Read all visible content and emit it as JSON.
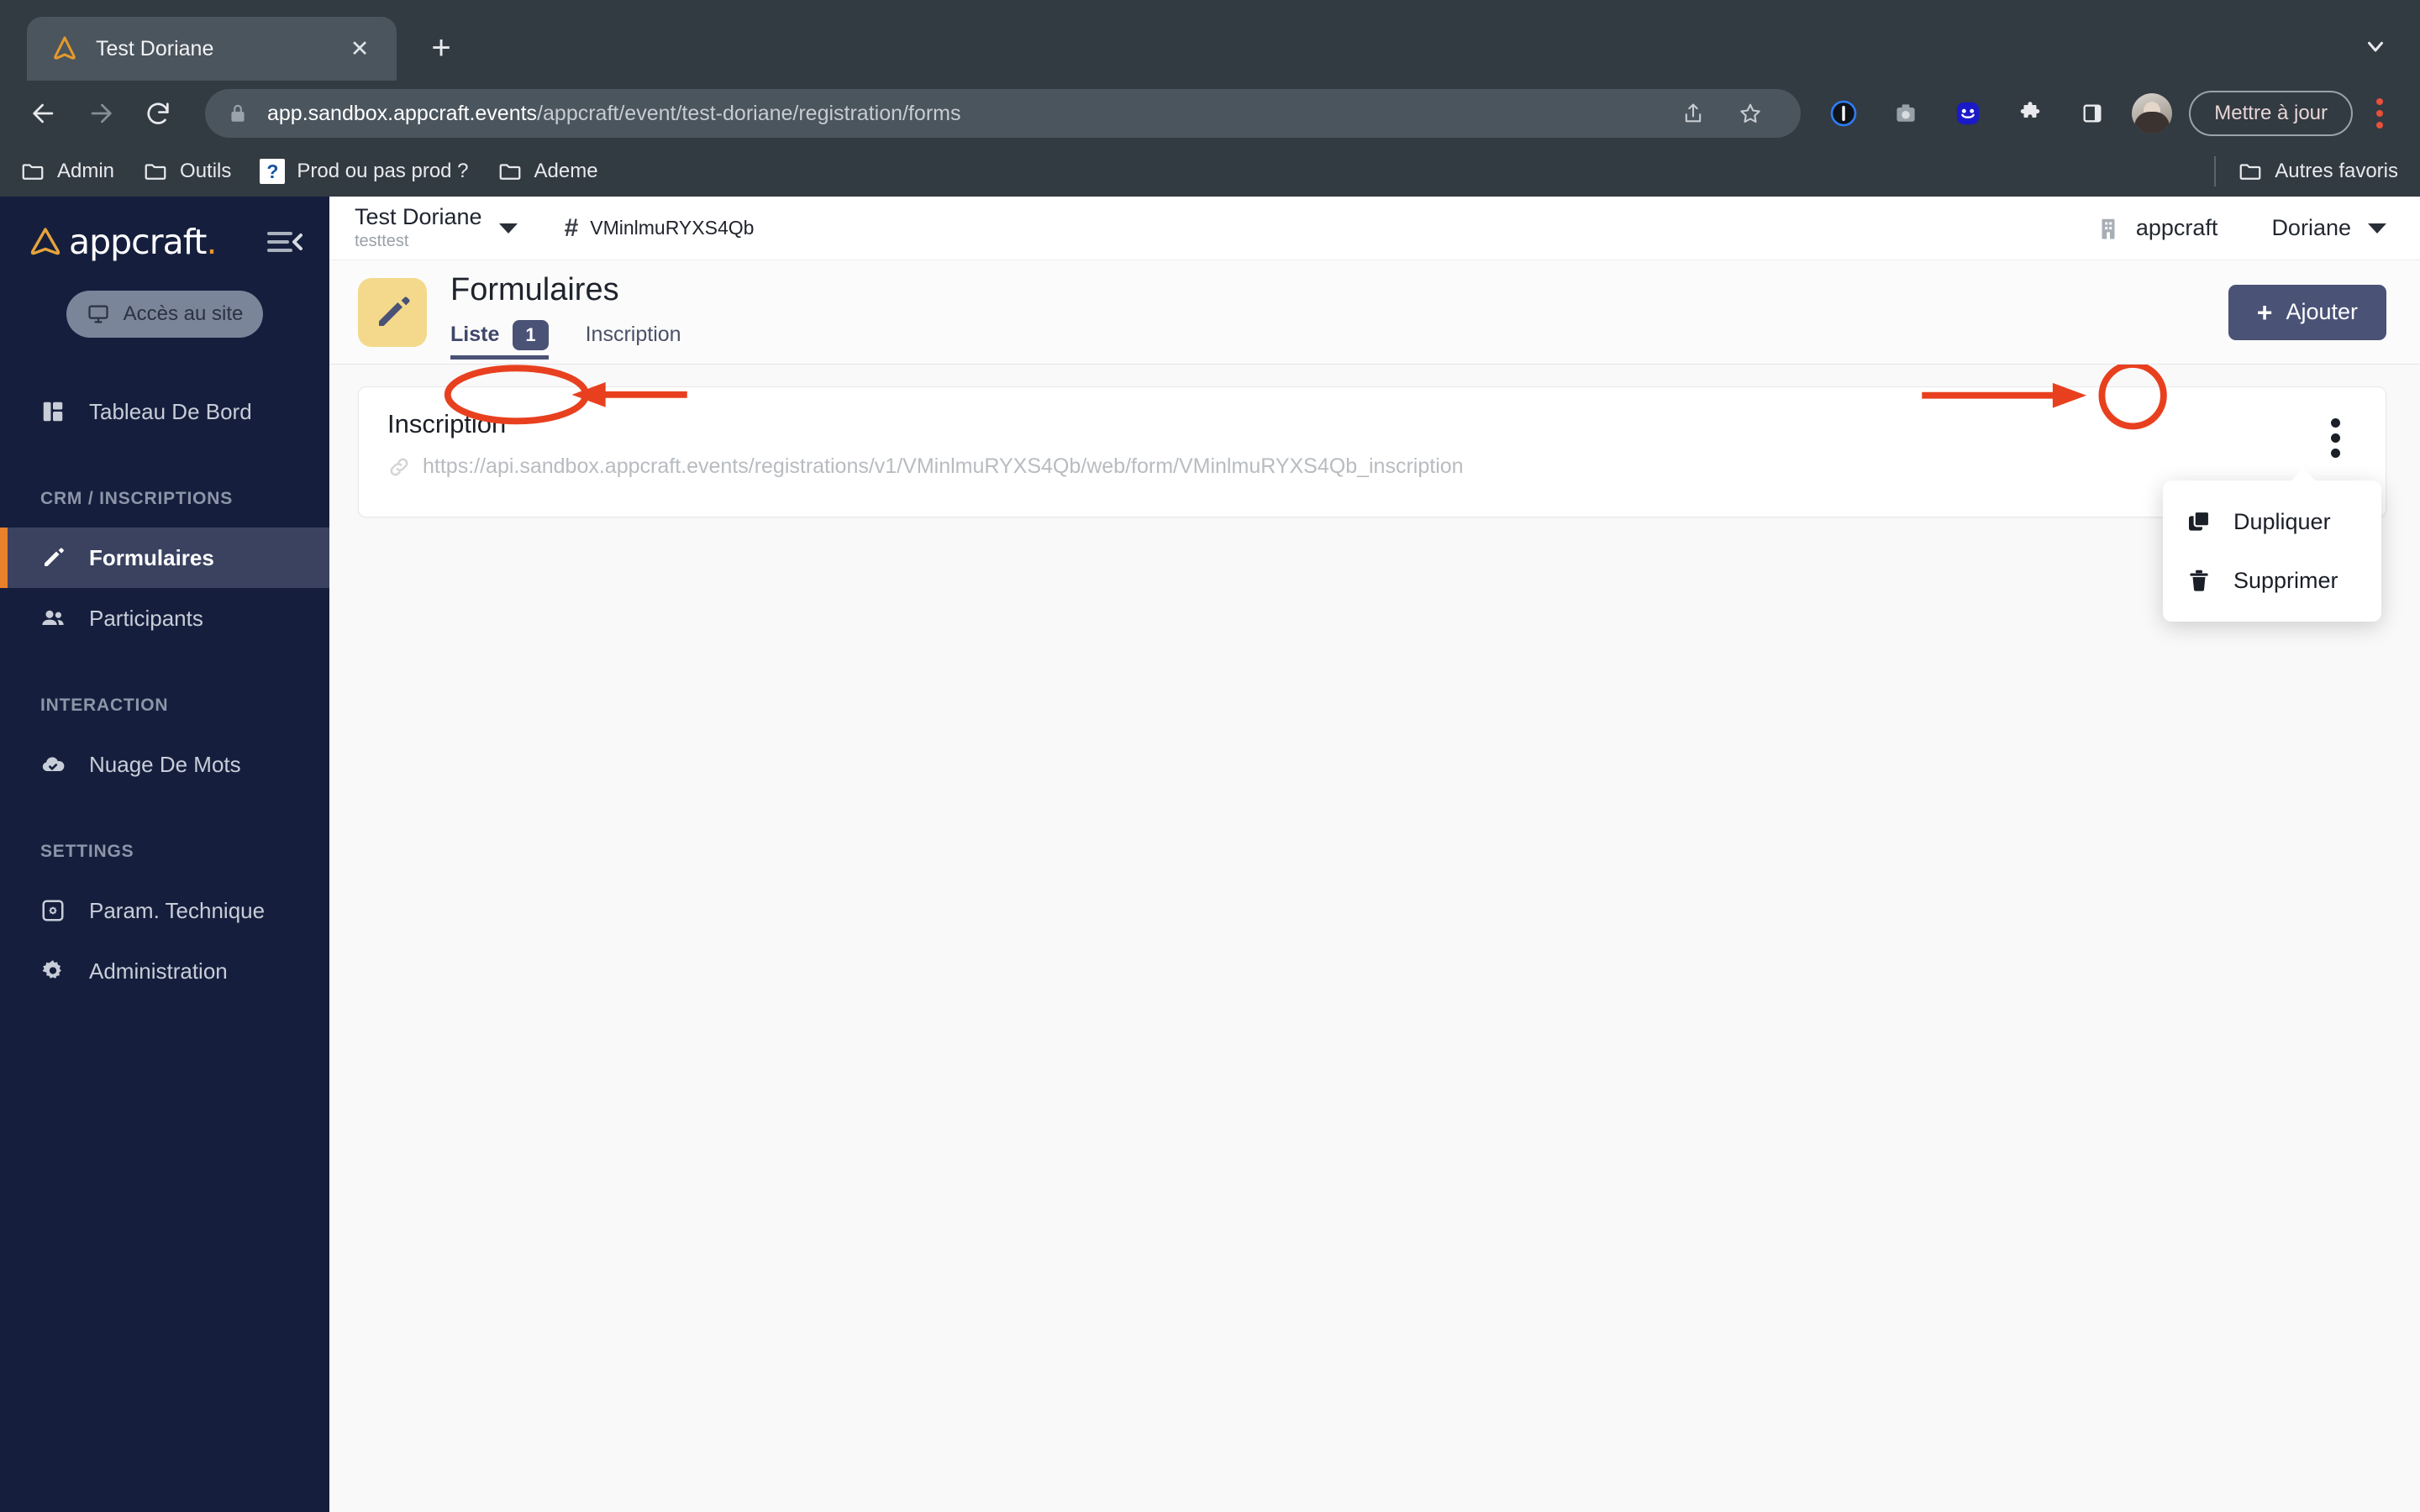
{
  "browser": {
    "tab": {
      "title": "Test Doriane",
      "favicon": "appcraft-logo-icon",
      "close": "✕"
    },
    "new_tab_label": "+",
    "url": {
      "host": "app.sandbox.appcraft.events",
      "path": "/appcraft/event/test-doriane/registration/forms"
    },
    "update_button": "Mettre à jour",
    "bookmarks": [
      {
        "label": "Admin",
        "icon": "folder-icon"
      },
      {
        "label": "Outils",
        "icon": "folder-icon"
      },
      {
        "label": "Prod ou pas prod ?",
        "icon": "question-icon"
      },
      {
        "label": "Ademe",
        "icon": "folder-icon"
      }
    ],
    "other_bookmarks": {
      "label": "Autres favoris",
      "icon": "folder-icon"
    }
  },
  "sidebar": {
    "brand": {
      "name": "appcraft",
      "dot": "."
    },
    "site_button": "Accès au site",
    "items": [
      {
        "label": "Tableau De Bord",
        "icon": "dashboard-icon",
        "active": false
      },
      {
        "label": "Formulaires",
        "icon": "pencil-icon",
        "active": true
      },
      {
        "label": "Participants",
        "icon": "people-icon",
        "active": false
      },
      {
        "label": "Nuage De Mots",
        "icon": "cloud-check-icon",
        "active": false
      },
      {
        "label": "Param. Technique",
        "icon": "settings-square-icon",
        "active": false
      },
      {
        "label": "Administration",
        "icon": "gear-icon",
        "active": false
      }
    ],
    "sections": {
      "crm": "CRM / INSCRIPTIONS",
      "interaction": "INTERACTION",
      "settings": "SETTINGS"
    }
  },
  "topbar": {
    "event_name": "Test Doriane",
    "event_sub": "testtest",
    "event_id": "VMinlmuRYXS4Qb",
    "hash": "#",
    "org": "appcraft",
    "user": "Doriane"
  },
  "page": {
    "title": "Formulaires",
    "tabs": [
      {
        "label": "Liste",
        "badge": "1",
        "active": true
      },
      {
        "label": "Inscription",
        "badge": null,
        "active": false
      }
    ],
    "add_button": "Ajouter",
    "add_plus": "+"
  },
  "form_card": {
    "title": "Inscription",
    "url": "https://api.sandbox.appcraft.events/registrations/v1/VMinlmuRYXS4Qb/web/form/VMinlmuRYXS4Qb_inscription"
  },
  "context_menu": {
    "items": [
      {
        "label": "Dupliquer",
        "icon": "copy-icon"
      },
      {
        "label": "Supprimer",
        "icon": "trash-icon"
      }
    ]
  },
  "colors": {
    "annotation_red": "#E8401F",
    "sidebar_bg": "#151F3D",
    "sidebar_active_bg": "#3A4260",
    "accent_orange": "#E8812C",
    "primary_indigo": "#4A5276",
    "page_icon_yellow": "#F4D98C",
    "browser_chrome": "#323A42"
  }
}
